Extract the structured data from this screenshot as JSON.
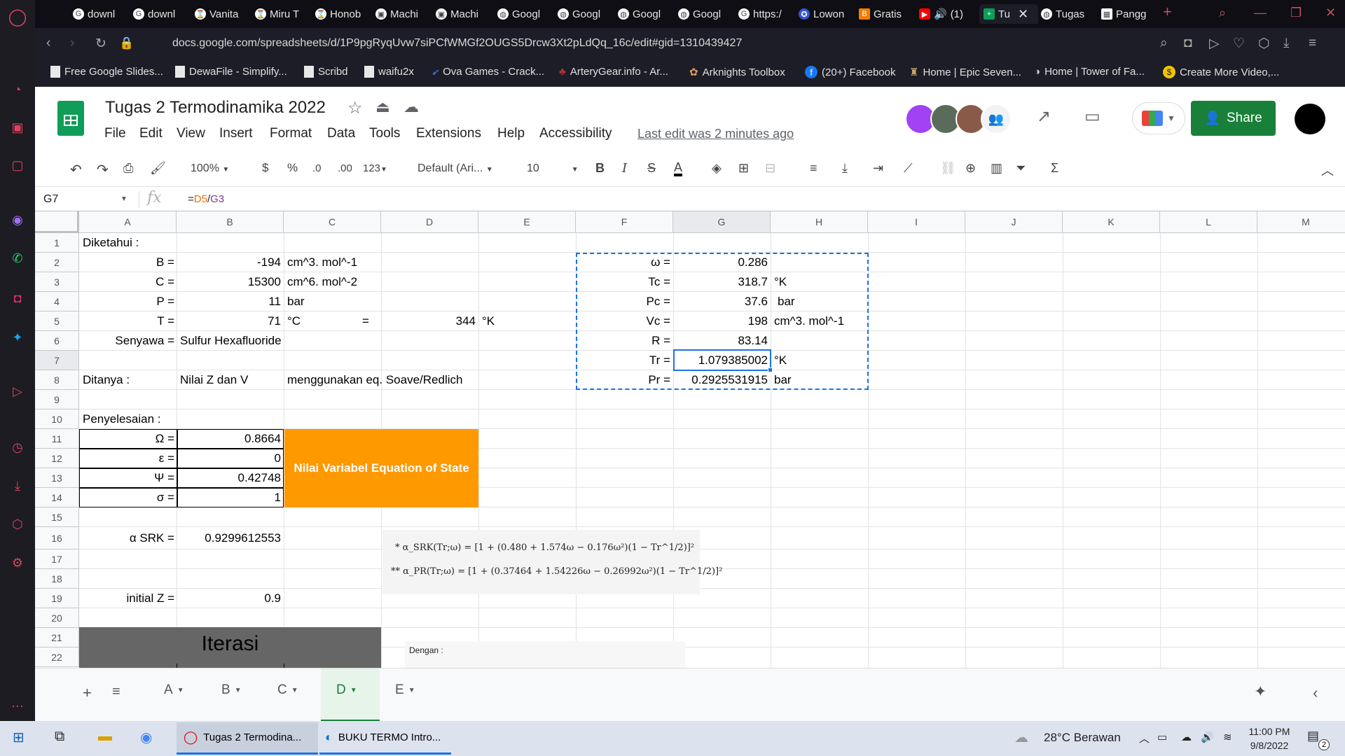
{
  "browser": {
    "tabs": [
      {
        "label": "downl",
        "icon": "G"
      },
      {
        "label": "downl",
        "icon": "G"
      },
      {
        "label": "Vanita",
        "icon": "⌛"
      },
      {
        "label": "Miru T",
        "icon": "⌛"
      },
      {
        "label": "Honob",
        "icon": "⌛"
      },
      {
        "label": "Machi",
        "icon": "▣"
      },
      {
        "label": "Machi",
        "icon": "▣"
      },
      {
        "label": "Googl",
        "icon": "◍"
      },
      {
        "label": "Googl",
        "icon": "◍"
      },
      {
        "label": "Googl",
        "icon": "◍"
      },
      {
        "label": "Googl",
        "icon": "◍"
      },
      {
        "label": "https:/",
        "icon": "G"
      },
      {
        "label": "Lowon",
        "icon": "✪"
      },
      {
        "label": "Gratis",
        "icon": "B"
      },
      {
        "label": "(1)",
        "icon": "▶"
      },
      {
        "label": "Tu",
        "icon": "+"
      },
      {
        "label": "Tugas",
        "icon": "◍"
      },
      {
        "label": "Pangg",
        "icon": "▦"
      }
    ],
    "url": "docs.google.com/spreadsheets/d/1P9pgRyqUvw7siPCfWMGf2OUGS5Drcw3Xt2pLdQq_16c/edit#gid=1310439427",
    "bookmarks": [
      "Free Google Slides...",
      "DewaFile - Simplify...",
      "Scribd",
      "waifu2x",
      "Ova Games - Crack...",
      "ArteryGear.info - Ar...",
      "Arknights Toolbox",
      "(20+) Facebook",
      "Home | Epic Seven...",
      "Home | Tower of Fa...",
      "Create More Video,..."
    ]
  },
  "sheets": {
    "title": "Tugas 2 Termodinamika 2022",
    "menu": [
      "File",
      "Edit",
      "View",
      "Insert",
      "Format",
      "Data",
      "Tools",
      "Extensions",
      "Help",
      "Accessibility"
    ],
    "last_edit": "Last edit was 2 minutes ago",
    "share_label": "Share",
    "toolbar": {
      "zoom": "100%",
      "currency": "$",
      "percent": "%",
      "dec_decrease": ".0",
      "dec_increase": ".00",
      "format_more": "123",
      "font": "Default (Ari...",
      "font_size": "10"
    },
    "name_box": "G7",
    "formula": {
      "ref1": "D5",
      "sep": "/",
      "ref2": "G3"
    },
    "columns": [
      "A",
      "B",
      "C",
      "D",
      "E",
      "F",
      "G",
      "H",
      "I",
      "J",
      "K",
      "L",
      "M"
    ],
    "rows": [
      "1",
      "2",
      "3",
      "4",
      "5",
      "6",
      "7",
      "8",
      "9",
      "10",
      "11",
      "12",
      "13",
      "14",
      "15",
      "16",
      "17",
      "18",
      "19",
      "20",
      "21",
      "22"
    ],
    "cells": {
      "A1": "Diketahui :",
      "A2": "B =",
      "B2": "-194",
      "C2": "cm^3. mol^-1",
      "A3": "C =",
      "B3": "15300",
      "C3": "cm^6. mol^-2",
      "A4": "P =",
      "B4": "11",
      "C4": "bar",
      "A5": "T =",
      "B5": "71",
      "C5": "°C",
      "C5b": "=",
      "D5": "344",
      "E5": "°K",
      "A6": "Senyawa =",
      "B6": "Sulfur Hexafluoride",
      "A8": "Ditanya :",
      "B8": "Nilai Z dan V",
      "C8": "menggunakan eq. Soave/Redlich",
      "A10": "Penyelesaian :",
      "A11": "Ω =",
      "B11": "0.8664",
      "A12": "ε =",
      "B12": "0",
      "A13": "Ψ =",
      "B13": "0.42748",
      "A14": "σ =",
      "B14": "1",
      "C11": "Nilai Variabel Equation of State",
      "A16": "α SRK =",
      "B16": "0.9299612553",
      "A19": "initial Z =",
      "B19": "0.9",
      "A21": "Iterasi",
      "F2": "ω =",
      "G2": "0.286",
      "F3": "Tc =",
      "G3": "318.7",
      "H3": "°K",
      "F4": "Pc =",
      "G4": "37.6",
      "H4": "bar",
      "F5": "Vc =",
      "G5": "198",
      "H5": "cm^3. mol^-1",
      "F6": "R =",
      "G6": "83.14",
      "F7": "Tr =",
      "G7": "1.079385002",
      "H7": "°K",
      "F8": "Pr =",
      "G8": "0.2925531915",
      "H8": "bar"
    },
    "formula_image": {
      "line1": "* α_SRK(Tr;ω) = [1 + (0.480 + 1.574ω − 0.176ω²)(1 − Tr^1/2)]²",
      "line2": "** α_PR(Tr;ω) = [1 + (0.37464 + 1.54226ω − 0.26992ω²)(1 − Tr^1/2)]²",
      "dengan": "Dengan :"
    },
    "sheet_tabs": [
      "A",
      "B",
      "C",
      "D",
      "E"
    ],
    "active_sheet": "D"
  },
  "taskbar": {
    "apps": [
      "Tugas 2 Termodina...",
      "BUKU TERMO Intro..."
    ],
    "weather": "28°C  Berawan",
    "time": "11:00 PM",
    "date": "9/8/2022",
    "notif_count": "2"
  },
  "colors": {
    "accent": "#188038",
    "header_orange": "#ff9900",
    "iter_gray": "#666666",
    "selection": "#1a73e8"
  }
}
